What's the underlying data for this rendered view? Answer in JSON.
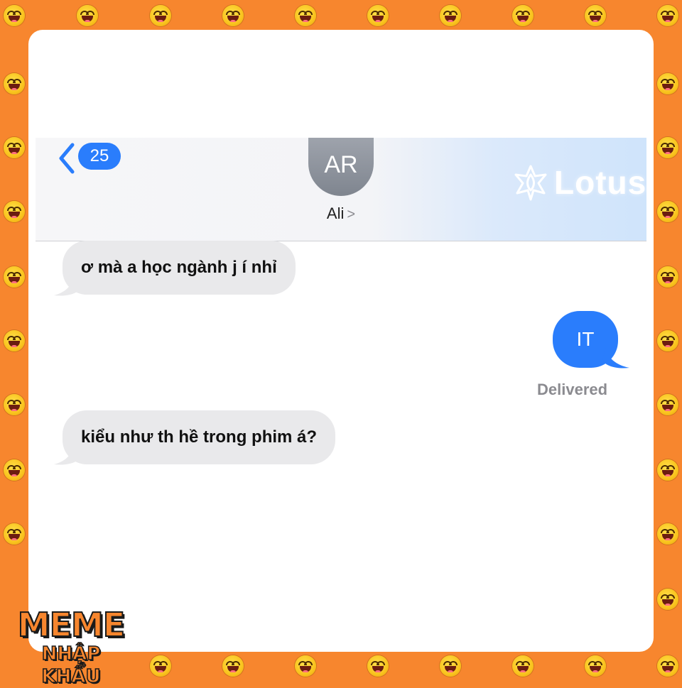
{
  "header": {
    "unread_count": "25",
    "avatar_initials": "AR",
    "contact_name": "Ali",
    "contact_chevron": ">",
    "watermark_brand": "Lotus"
  },
  "messages": [
    {
      "direction": "incoming",
      "text": "ơ mà a học ngành j í nhỉ"
    },
    {
      "direction": "outgoing",
      "text": "IT",
      "status": "Delivered"
    },
    {
      "direction": "incoming",
      "text": "kiểu như th hề trong phim á?"
    }
  ],
  "logo": {
    "line1": "MEME",
    "line2": "NHẬP KHẨU"
  },
  "colors": {
    "frame": "#f7862e",
    "ios_blue": "#2a7dfc",
    "incoming_bubble": "#e9e9eb"
  },
  "icons": [
    "back-chevron-icon",
    "laughing-emoji-icon",
    "lotus-flower-icon"
  ]
}
